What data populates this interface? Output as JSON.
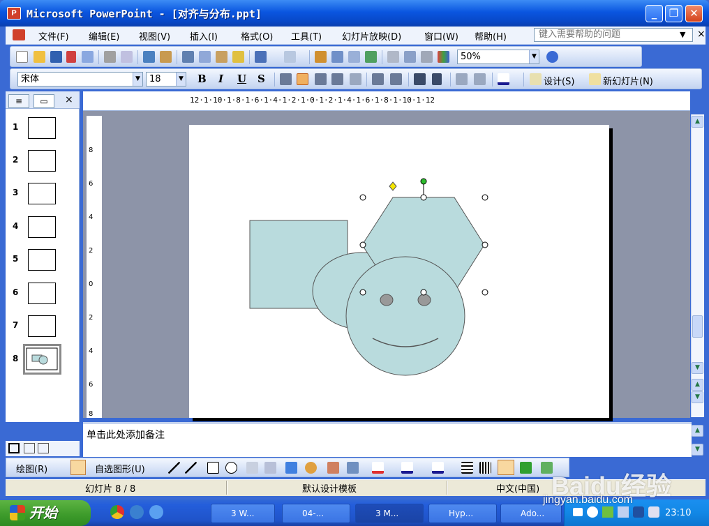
{
  "window": {
    "app_icon": "P",
    "title": "Microsoft PowerPoint - [对齐与分布.ppt]",
    "minimize": "_",
    "restore": "❐",
    "close": "✕"
  },
  "menu": {
    "items": [
      "文件(F)",
      "编辑(E)",
      "视图(V)",
      "插入(I)",
      "格式(O)",
      "工具(T)",
      "幻灯片放映(D)",
      "窗口(W)",
      "帮助(H)"
    ],
    "help_placeholder": "键入需要帮助的问题",
    "close": "×"
  },
  "toolbar_standard": {
    "zoom": "50%"
  },
  "toolbar_format": {
    "font": "宋体",
    "size": "18",
    "bold": "B",
    "italic": "I",
    "underline": "U",
    "shadow": "S",
    "design": "设计(S)",
    "new_slide": "新幻灯片(N)"
  },
  "outline_pane": {
    "tabs": [
      "≡",
      "▭"
    ],
    "close": "×",
    "slides": [
      "1",
      "2",
      "3",
      "4",
      "5",
      "6",
      "7",
      "8"
    ],
    "current": "8"
  },
  "ruler": {
    "horizontal": "12·1·10·1·8·1·6·1·4·1·2·1·0·1·2·1·4·1·6·1·8·1·10·1·12",
    "vertical": [
      "8",
      "6",
      "4",
      "2",
      "0",
      "2",
      "4",
      "6",
      "8"
    ]
  },
  "notes": {
    "placeholder": "单击此处添加备注"
  },
  "drawing_toolbar": {
    "draw": "绘图(R)",
    "autoshapes": "自选图形(U)"
  },
  "status": {
    "slide": "幻灯片 8 / 8",
    "template": "默认设计模板",
    "language": "中文(中国)"
  },
  "taskbar": {
    "start": "开始",
    "tasks": [
      "3 W...",
      "04-...",
      "3 M...",
      "Hyp...",
      "Ado..."
    ],
    "clock": "23:10"
  },
  "watermark": {
    "logo": "Baidu经验",
    "url": "jingyan.baidu.com"
  },
  "colors": {
    "shape_fill": "#b9dbdd",
    "shape_stroke": "#555555",
    "selection_handle_rotate": "#2dbd2d",
    "selection_handle_adjust": "#f5e600"
  }
}
